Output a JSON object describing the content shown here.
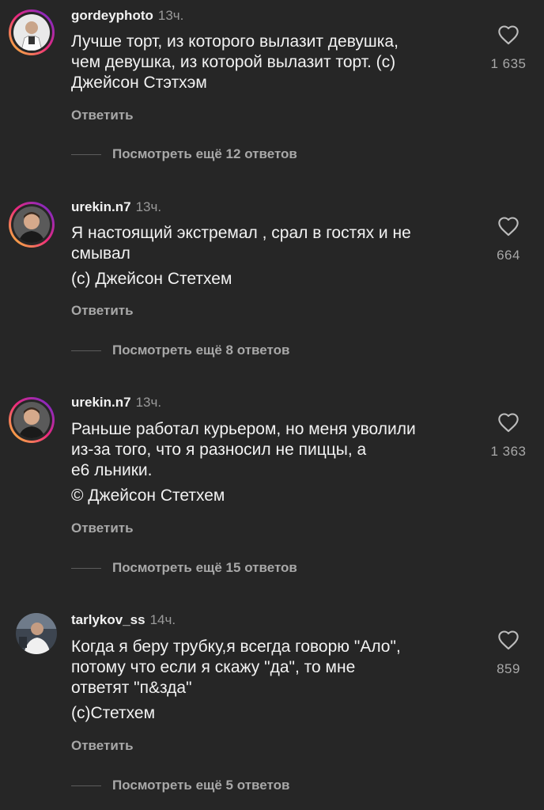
{
  "comments": [
    {
      "username": "gordeyphoto",
      "time": "13ч.",
      "lines": [
        "Лучше торт, из которого вылазит девушка,",
        "чем девушка, из которой вылазит торт. (с)",
        "Джейсон Стэтхэм"
      ],
      "reply_label": "Ответить",
      "more_replies": "Посмотреть ещё 12 ответов",
      "likes": "1 635",
      "heart_icon": "heart-outline-icon",
      "story_ring": true
    },
    {
      "username": "urekin.n7",
      "time": "13ч.",
      "lines": [
        "Я настоящий экстремал , срал в гостях и не",
        "смывал",
        "(с) Джейсон Стетхем"
      ],
      "reply_label": "Ответить",
      "more_replies": "Посмотреть ещё 8 ответов",
      "likes": "664",
      "heart_icon": "heart-outline-icon",
      "story_ring": true
    },
    {
      "username": "urekin.n7",
      "time": "13ч.",
      "lines": [
        "Раньше работал курьером, но меня уволили",
        "из-за того, что я разносил не пиццы, а",
        "е6  льники.",
        "© Джейсон Стетхем"
      ],
      "reply_label": "Ответить",
      "more_replies": "Посмотреть ещё 15 ответов",
      "likes": "1 363",
      "heart_icon": "heart-outline-icon",
      "story_ring": true
    },
    {
      "username": "tarlykov_ss",
      "time": "14ч.",
      "lines": [
        "Когда я беру трубку,я всегда говорю \"Ало\",",
        "потому что если я скажу \"да\", то мне",
        "ответят \"п&зда\"",
        "(с)Стетхем"
      ],
      "reply_label": "Ответить",
      "more_replies": "Посмотреть ещё 5 ответов",
      "likes": "859",
      "heart_icon": "heart-outline-icon",
      "story_ring": false
    }
  ],
  "colors": {
    "background": "#262626",
    "text_primary": "#f2f2f2",
    "text_secondary": "#a8a8a8",
    "story_ring_start": "#f9ce34",
    "story_ring_mid": "#ee2a7b",
    "story_ring_end": "#6228d7"
  }
}
